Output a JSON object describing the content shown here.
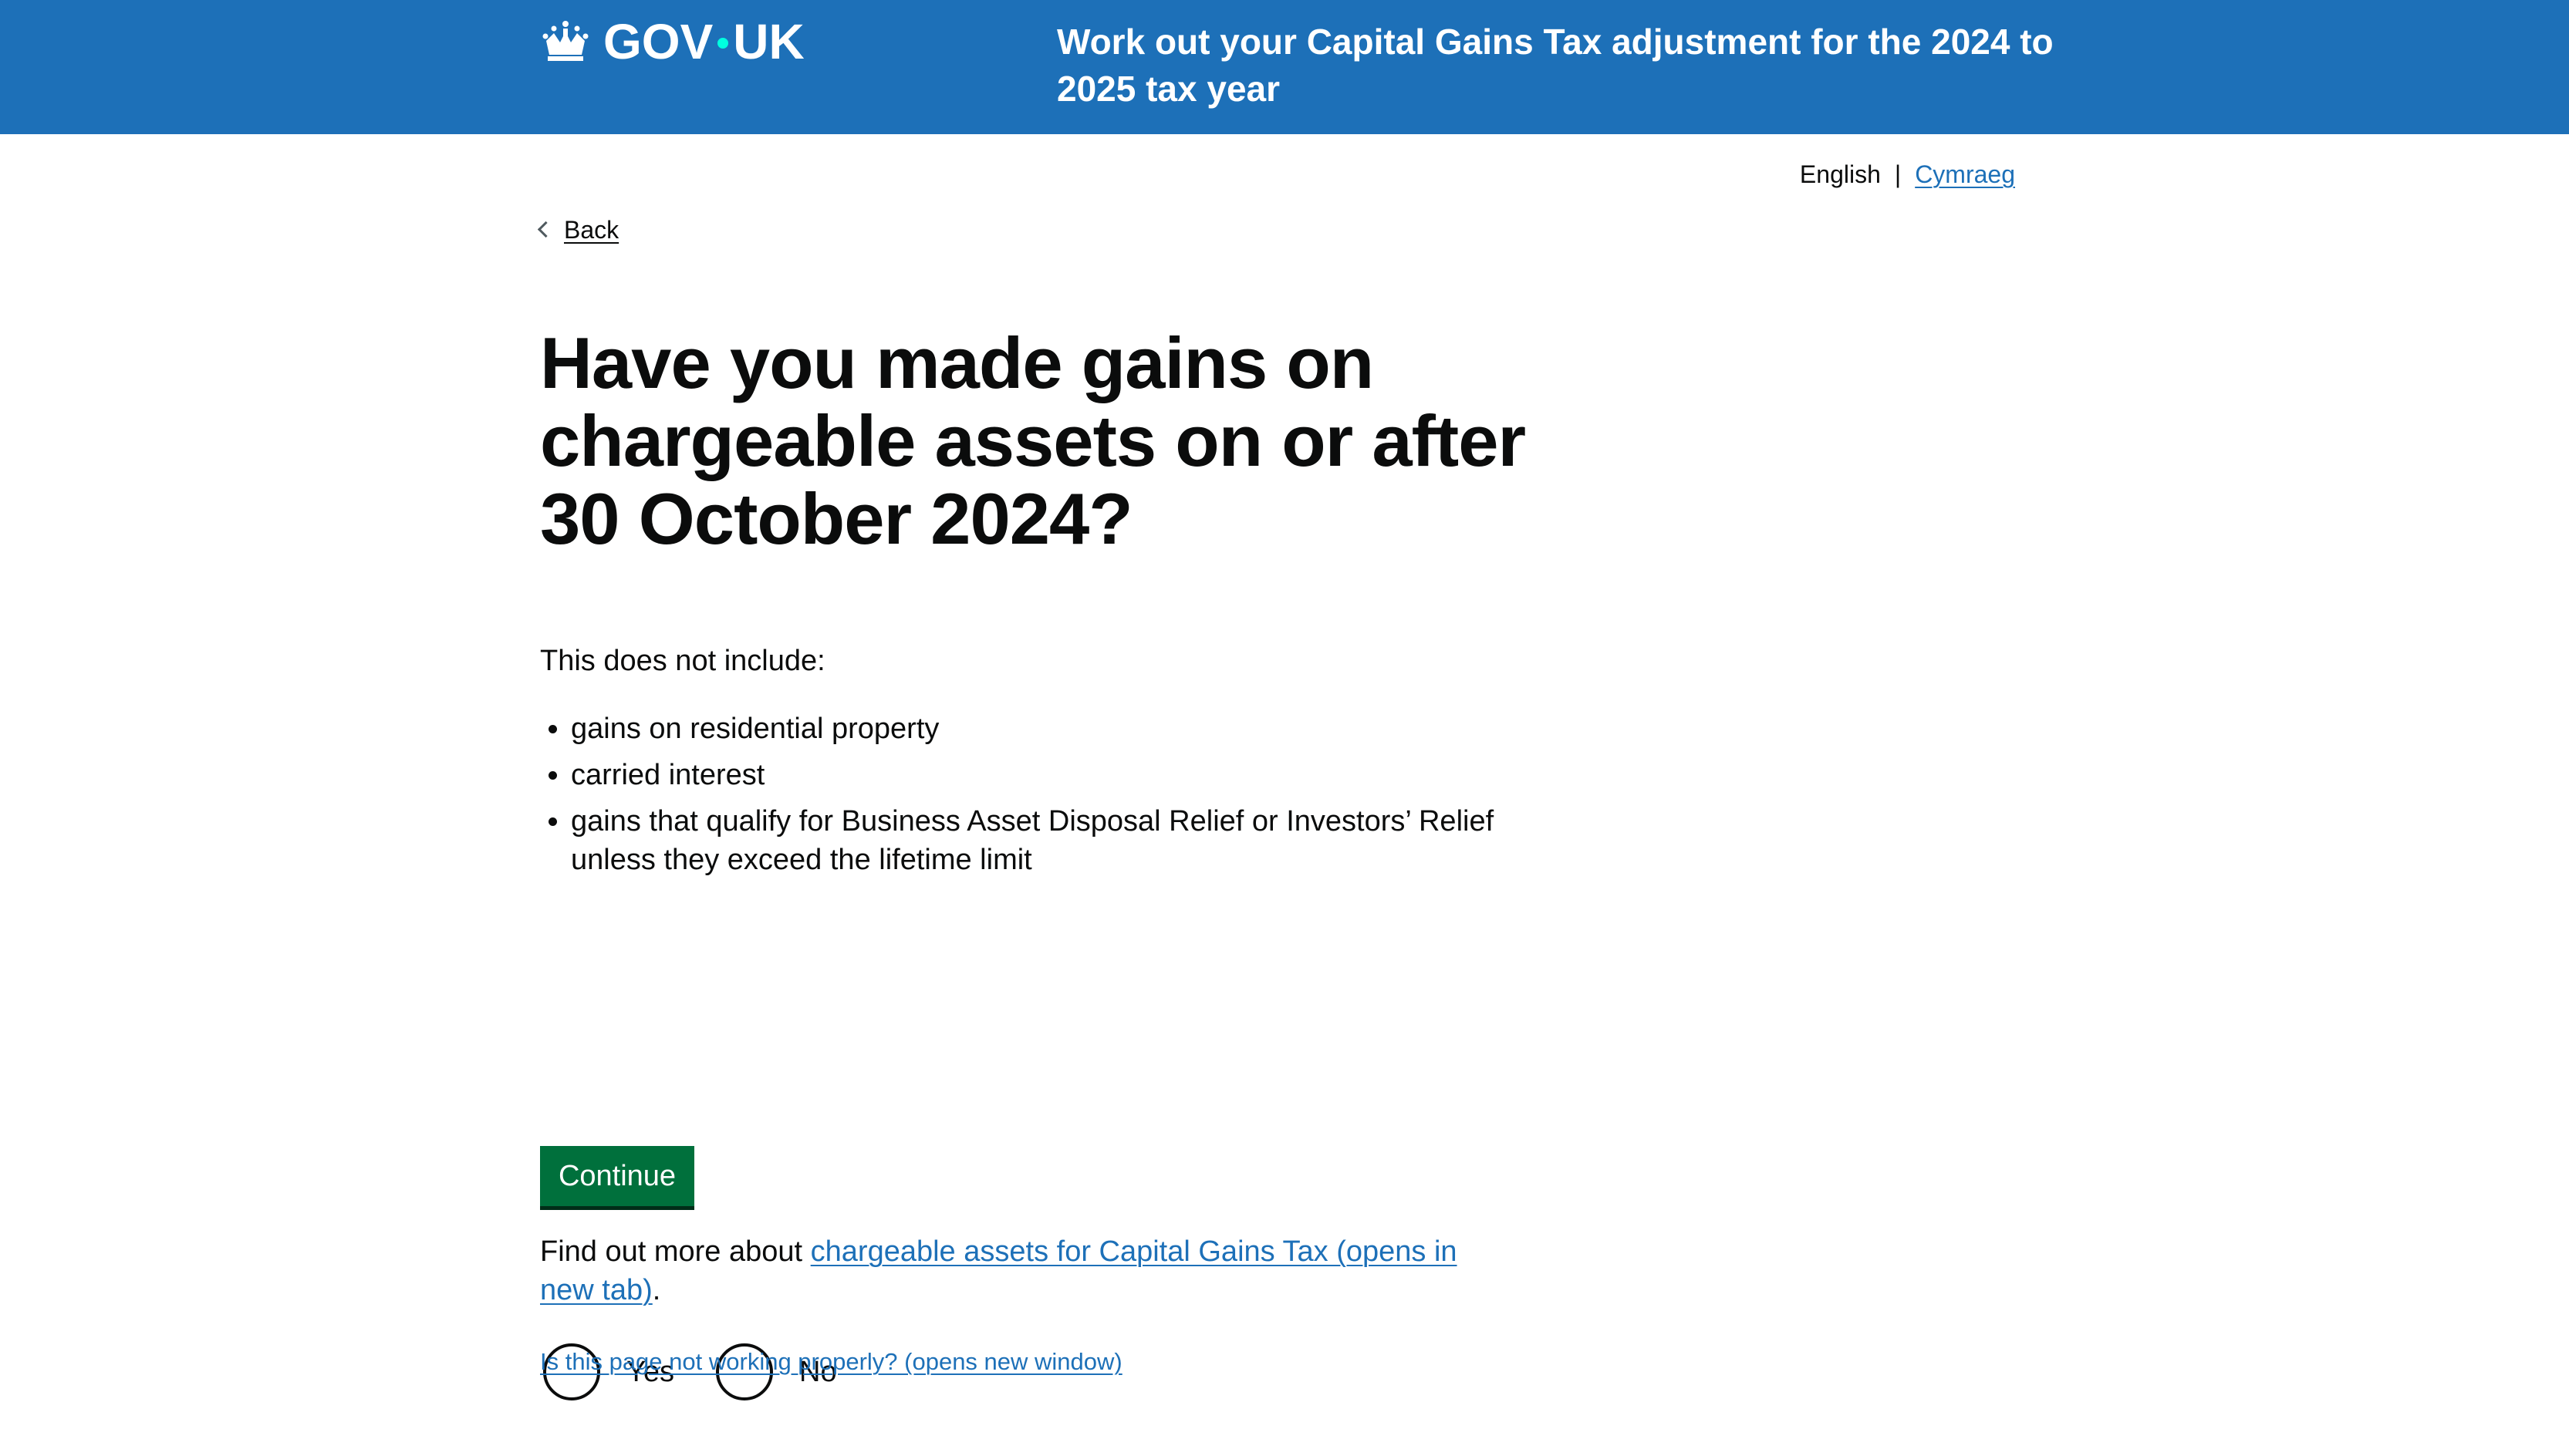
{
  "header": {
    "logo_text_left": "GOV",
    "logo_text_right": "UK",
    "service_name": "Work out your Capital Gains Tax adjustment for the 2024 to 2025 tax year"
  },
  "language": {
    "current": "English",
    "separator": "|",
    "alternate": "Cymraeg"
  },
  "nav": {
    "back_label": "Back"
  },
  "question": {
    "heading": "Have you made gains on chargeable assets on or after 30 October 2024?",
    "intro": "This does not include:",
    "exclusions": [
      "gains on residential property",
      "carried interest",
      "gains that qualify for Business Asset Disposal Relief or Investors’ Relief unless they exceed the lifetime limit"
    ],
    "more_prefix": "Find out more about ",
    "more_link": "chargeable assets for Capital Gains Tax (opens in new tab)",
    "more_suffix": "."
  },
  "options": {
    "yes_label": "Yes",
    "no_label": "No"
  },
  "actions": {
    "continue_label": "Continue"
  },
  "footer": {
    "report_link": "Is this page not working properly? (opens new window)"
  },
  "colors": {
    "header_bg": "#1d70b8",
    "link": "#1d70b8",
    "button_bg": "#00703c",
    "logo_dot": "#00ffe0",
    "text": "#0b0c0c"
  }
}
